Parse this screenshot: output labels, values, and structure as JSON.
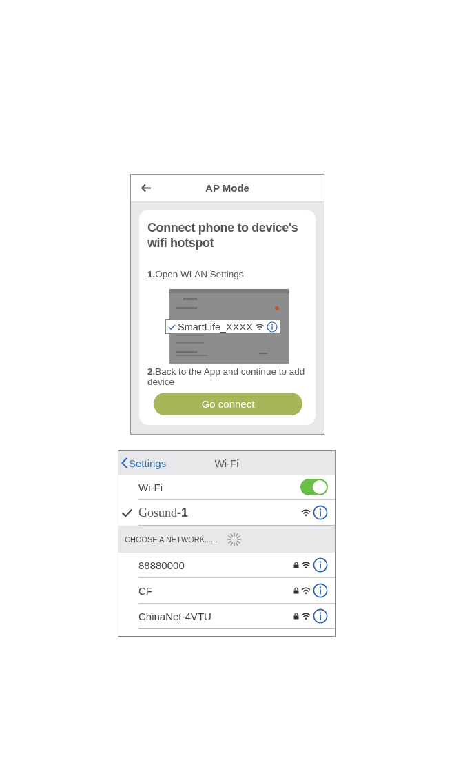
{
  "ap_mode": {
    "title": "AP Mode",
    "heading": "Connect phone to device's wifi hotspot",
    "steps": [
      "**1.**Open WLAN Settings",
      "**2.**Back to the App and continue to add device"
    ],
    "callout": {
      "network": "SmartLife_XXXX",
      "checked": true
    },
    "button": "Go connect"
  },
  "wifi_settings": {
    "back": "Settings",
    "title": "Wi-Fi",
    "toggle": {
      "label": "Wi-Fi",
      "on": true
    },
    "connected": {
      "name": "Gosund**-1**",
      "checked": true
    },
    "section": "CHOOSE A NETWORK......",
    "networks": [
      {
        "name": "88880000",
        "locked": true
      },
      {
        "name": "CF",
        "locked": true
      },
      {
        "name": "ChinaNet-4VTU",
        "locked": true
      }
    ]
  }
}
